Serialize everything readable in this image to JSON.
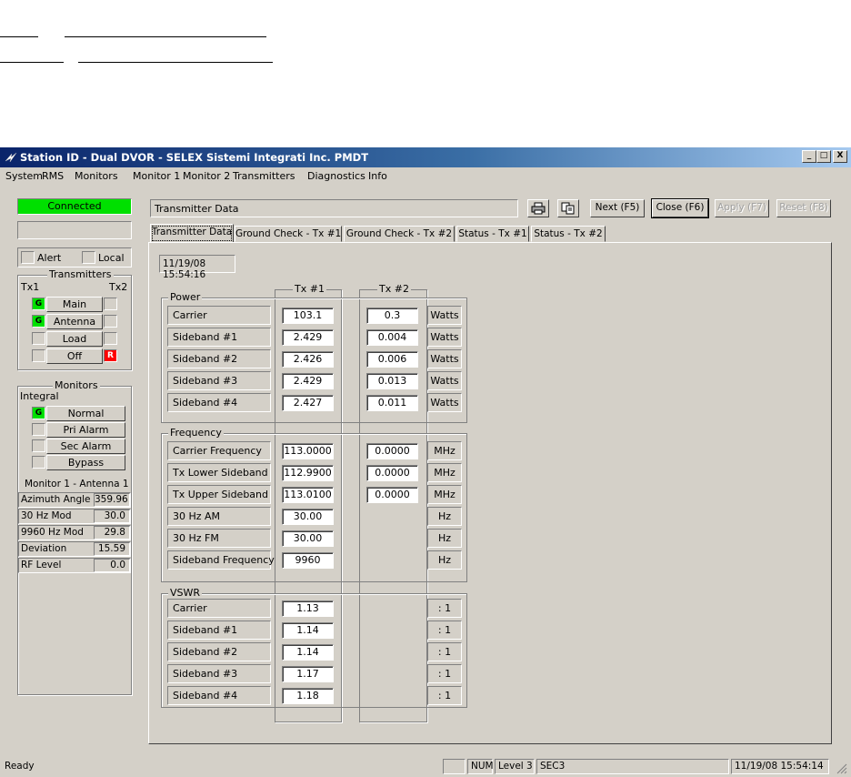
{
  "window": {
    "title": "Station ID - Dual DVOR - SELEX Sistemi Integrati Inc. PMDT",
    "controls": {
      "minimize": "_",
      "maximize": "□",
      "close": "X"
    }
  },
  "menu": [
    "System",
    "RMS",
    "Monitors",
    "Monitor 1",
    "Monitor 2",
    "Transmitters",
    "Diagnostics",
    "Info"
  ],
  "left": {
    "connection_status": "Connected",
    "connection_color": "#00e000",
    "alert_label": "Alert",
    "local_label": "Local",
    "transmitters": {
      "title": "Transmitters",
      "tx1": "Tx1",
      "tx2": "Tx2",
      "rows": [
        {
          "label": "Main",
          "left": "G",
          "right": ""
        },
        {
          "label": "Antenna",
          "left": "G",
          "right": ""
        },
        {
          "label": "Load",
          "left": "",
          "right": ""
        },
        {
          "label": "Off",
          "left": "",
          "right": "R"
        }
      ]
    },
    "monitors": {
      "title": "Monitors",
      "subtitle": "Integral",
      "rows": [
        {
          "label": "Normal",
          "state": "G"
        },
        {
          "label": "Pri Alarm",
          "state": ""
        },
        {
          "label": "Sec Alarm",
          "state": ""
        },
        {
          "label": "Bypass",
          "state": ""
        }
      ],
      "monitor_title": "Monitor 1 - Antenna 1",
      "readings": [
        {
          "label": "Azimuth Angle",
          "value": "359.96"
        },
        {
          "label": "30 Hz Mod",
          "value": "30.0"
        },
        {
          "label": "9960 Hz Mod",
          "value": "29.8"
        },
        {
          "label": "Deviation",
          "value": "15.59"
        },
        {
          "label": "RF Level",
          "value": "0.0"
        }
      ]
    }
  },
  "toolbar": {
    "title": "Transmitter Data",
    "print_icon": "printer-icon",
    "copy_icon": "copy-icon",
    "next": "Next (F5)",
    "close": "Close (F6)",
    "apply": "Apply (F7)",
    "reset": "Reset (F8)"
  },
  "tabs": [
    "Transmitter Data",
    "Ground Check - Tx #1",
    "Ground Check - Tx #2",
    "Status - Tx #1",
    "Status - Tx #2"
  ],
  "timestamp": "11/19/08 15:54:16",
  "columns": {
    "tx1": "Tx #1",
    "tx2": "Tx #2"
  },
  "power": {
    "title": "Power",
    "rows": [
      {
        "label": "Carrier",
        "tx1": "103.1",
        "tx2": "0.3",
        "unit": "Watts"
      },
      {
        "label": "Sideband #1",
        "tx1": "2.429",
        "tx2": "0.004",
        "unit": "Watts"
      },
      {
        "label": "Sideband #2",
        "tx1": "2.426",
        "tx2": "0.006",
        "unit": "Watts"
      },
      {
        "label": "Sideband #3",
        "tx1": "2.429",
        "tx2": "0.013",
        "unit": "Watts"
      },
      {
        "label": "Sideband #4",
        "tx1": "2.427",
        "tx2": "0.011",
        "unit": "Watts"
      }
    ]
  },
  "frequency": {
    "title": "Frequency",
    "rows": [
      {
        "label": "Carrier Frequency",
        "tx1": "113.0000",
        "tx2": "0.0000",
        "unit": "MHz"
      },
      {
        "label": "Tx Lower Sideband",
        "tx1": "112.9900",
        "tx2": "0.0000",
        "unit": "MHz"
      },
      {
        "label": "Tx Upper Sideband",
        "tx1": "113.0100",
        "tx2": "0.0000",
        "unit": "MHz"
      },
      {
        "label": "30 Hz AM",
        "tx1": "30.00",
        "tx2": null,
        "unit": "Hz"
      },
      {
        "label": "30 Hz FM",
        "tx1": "30.00",
        "tx2": null,
        "unit": "Hz"
      },
      {
        "label": "Sideband Frequency",
        "tx1": "9960",
        "tx2": null,
        "unit": "Hz"
      }
    ]
  },
  "vswr": {
    "title": "VSWR",
    "rows": [
      {
        "label": "Carrier",
        "tx1": "1.13",
        "unit": ": 1"
      },
      {
        "label": "Sideband #1",
        "tx1": "1.14",
        "unit": ": 1"
      },
      {
        "label": "Sideband #2",
        "tx1": "1.14",
        "unit": ": 1"
      },
      {
        "label": "Sideband #3",
        "tx1": "1.17",
        "unit": ": 1"
      },
      {
        "label": "Sideband #4",
        "tx1": "1.18",
        "unit": ": 1"
      }
    ]
  },
  "statusbar": {
    "message": "Ready",
    "num": "NUM",
    "level": "Level 3",
    "section": "SEC3",
    "datetime": "11/19/08 15:54:14"
  }
}
